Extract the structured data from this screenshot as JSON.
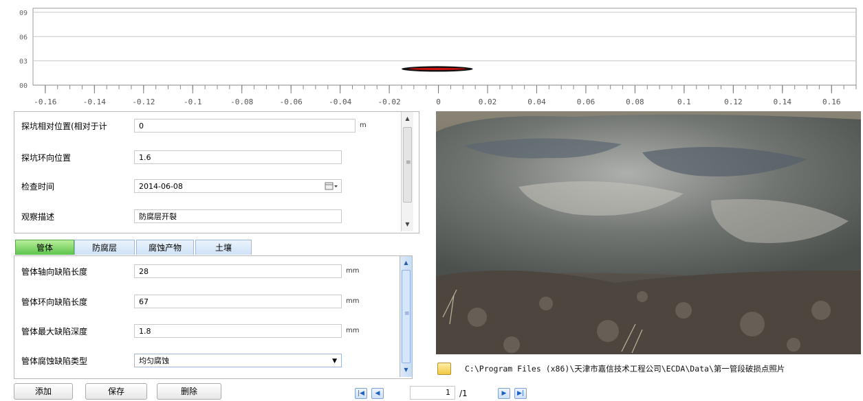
{
  "chart_data": {
    "type": "scatter",
    "title": "",
    "xlabel": "",
    "ylabel": "",
    "x_ticks": [
      "-0.16",
      "-0.14",
      "-0.12",
      "-0.1",
      "-0.08",
      "-0.06",
      "-0.04",
      "-0.02",
      "0",
      "0.02",
      "0.04",
      "0.06",
      "0.08",
      "0.1",
      "0.12",
      "0.14",
      "0.16"
    ],
    "y_ticks": [
      "00",
      "03",
      "06",
      "09"
    ],
    "xlim": [
      -0.165,
      0.17
    ],
    "ylim": [
      0,
      0.95
    ],
    "grid": true,
    "marker": {
      "x_start": -0.015,
      "x_end": 0.014,
      "y": 0.2,
      "color": "#cc1111"
    }
  },
  "info": {
    "fields": [
      {
        "label": "探坑相对位置(相对于计",
        "value": "0",
        "unit": "m"
      },
      {
        "label": "探坑环向位置",
        "value": "1.6"
      },
      {
        "label": "检查时间",
        "value": "2014-06-08"
      },
      {
        "label": "观察描述",
        "value": "防腐层开裂"
      }
    ]
  },
  "tabs": [
    {
      "label": "管体",
      "active": true
    },
    {
      "label": "防腐层"
    },
    {
      "label": "腐蚀产物"
    },
    {
      "label": "土壤"
    }
  ],
  "pipe": {
    "fields": [
      {
        "label": "管体轴向缺陷长度",
        "value": "28",
        "unit": "mm"
      },
      {
        "label": "管体环向缺陷长度",
        "value": "67",
        "unit": "mm"
      },
      {
        "label": "管体最大缺陷深度",
        "value": "1.8",
        "unit": "mm"
      },
      {
        "label": "管体腐蚀缺陷类型",
        "value": "均匀腐蚀"
      }
    ]
  },
  "photo": {
    "path": "C:\\Program Files (x86)\\天津市嘉信技术工程公司\\ECDA\\Data\\第一管段破损点照片"
  },
  "buttons": {
    "add": "添加",
    "save": "保存",
    "delete": "删除"
  },
  "pager": {
    "current": "1",
    "total": "/1"
  },
  "colors": {
    "tab_active": "#5cc44a",
    "marker": "#cc1111",
    "nav": "#1f5fc6"
  }
}
